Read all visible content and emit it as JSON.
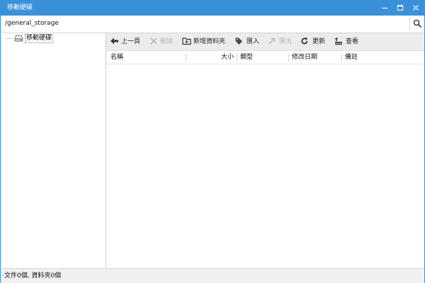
{
  "window": {
    "title": "移動硬碟",
    "accent_color": "#3b91d9"
  },
  "address": {
    "path": "/general_storage",
    "search_icon": "search-icon"
  },
  "tree": {
    "items": [
      {
        "label": "移動硬碟",
        "icon": "drive-icon"
      }
    ]
  },
  "toolbar": {
    "back_label": "上一頁",
    "delete_label": "刪除",
    "new_folder_label": "新增資料夾",
    "import_label": "匯入",
    "export_label": "匯出",
    "refresh_label": "更新",
    "view_label": "查看"
  },
  "list": {
    "columns": [
      "名稱",
      "大小",
      "類型",
      "修改日期",
      "備註"
    ],
    "rows": []
  },
  "status": {
    "text": "文件0個, 資料夾0個"
  }
}
